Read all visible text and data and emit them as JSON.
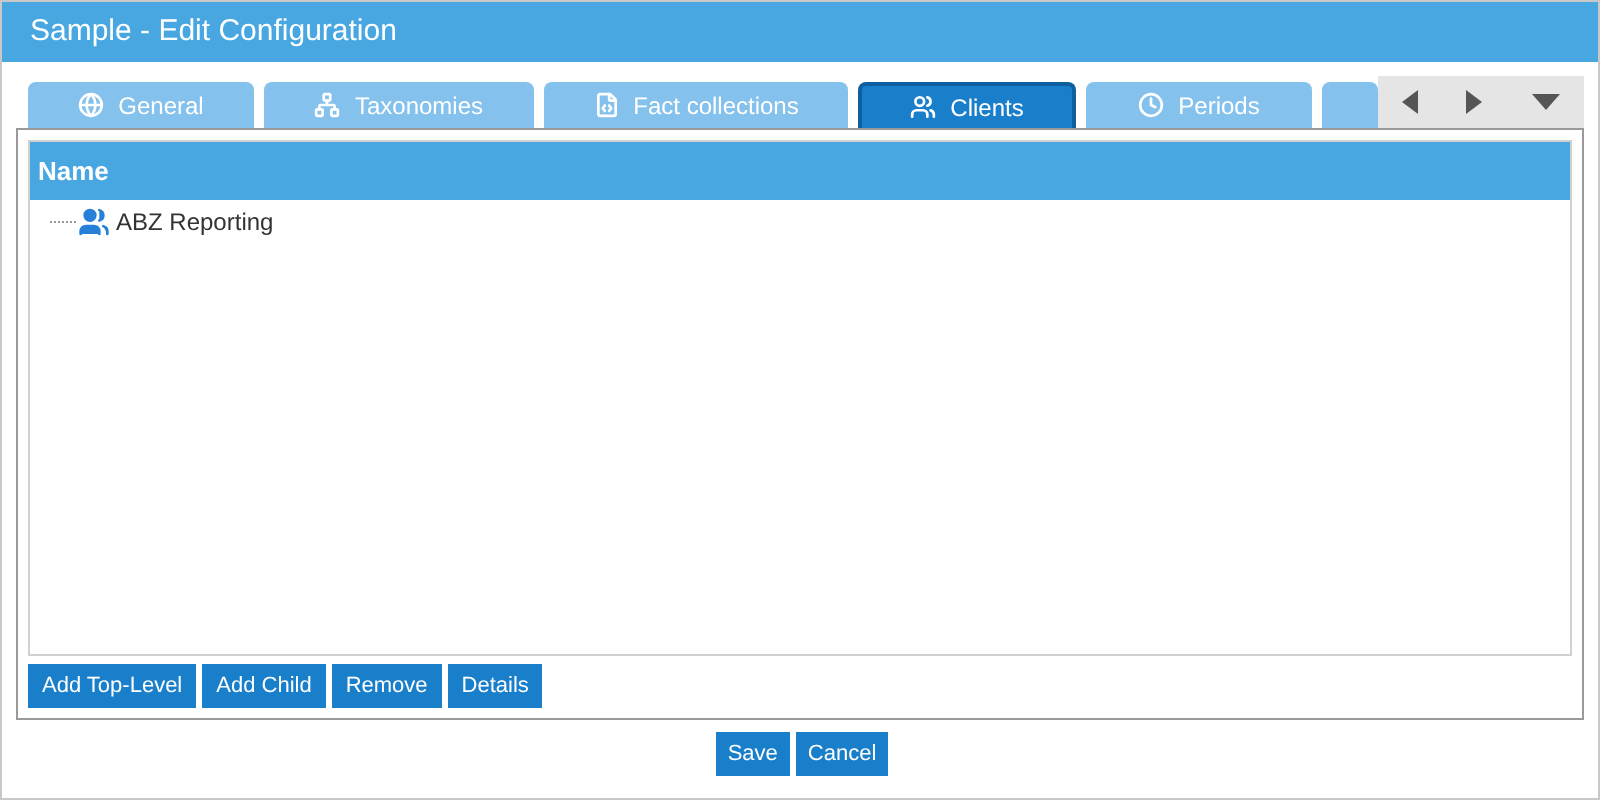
{
  "window": {
    "title": "Sample - Edit Configuration"
  },
  "tabs": [
    {
      "kind": "general",
      "label": "General",
      "selected": false
    },
    {
      "kind": "taxonomies",
      "label": "Taxonomies",
      "selected": false
    },
    {
      "kind": "facts",
      "label": "Fact collections",
      "selected": false
    },
    {
      "kind": "clients",
      "label": "Clients",
      "selected": true
    },
    {
      "kind": "periods",
      "label": "Periods",
      "selected": false
    },
    {
      "kind": "cut",
      "selected": false
    }
  ],
  "tree": {
    "columns": [
      "Name"
    ],
    "items": [
      {
        "label": "ABZ Reporting"
      }
    ]
  },
  "tree_buttons": [
    "Add Top-Level",
    "Add Child",
    "Remove",
    "Details"
  ],
  "footer_buttons": [
    "Save",
    "Cancel"
  ]
}
